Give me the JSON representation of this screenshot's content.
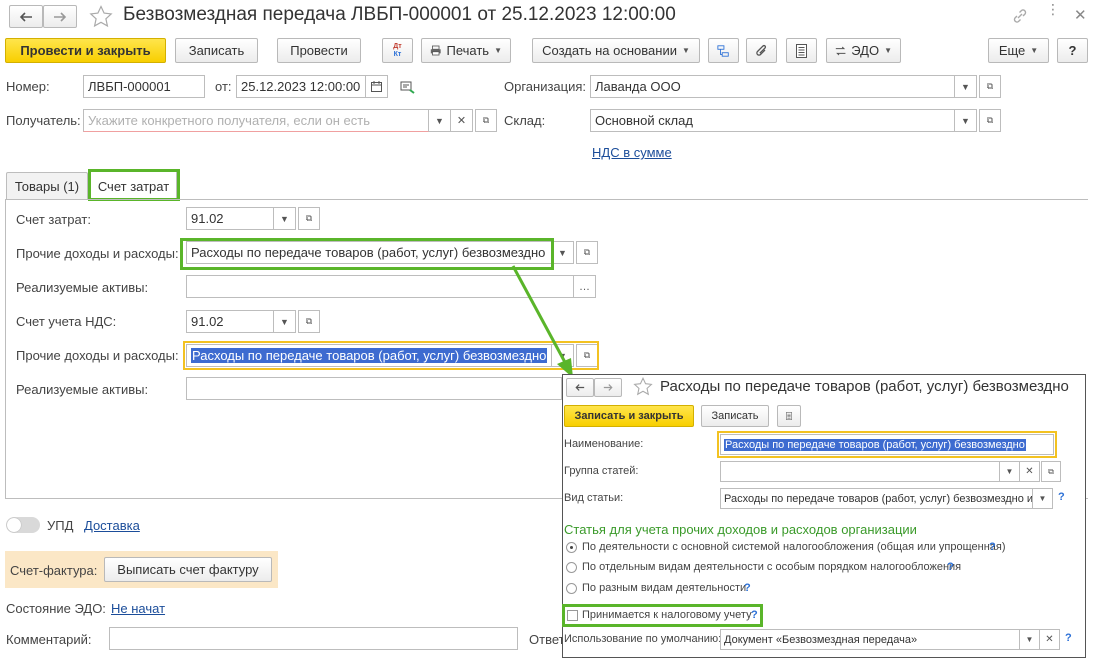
{
  "window": {
    "title": "Безвозмездная передача ЛВБП-000001 от 25.12.2023 12:00:00"
  },
  "toolbar": {
    "post_close": "Провести и закрыть",
    "save": "Записать",
    "post": "Провести",
    "dtkt": "Дт\nКт",
    "print": "Печать",
    "create_based": "Создать на основании",
    "edo": "ЭДО",
    "more": "Еще",
    "help": "?"
  },
  "header": {
    "number_label": "Номер:",
    "number_value": "ЛВБП-000001",
    "date_label": "от:",
    "date_value": "25.12.2023 12:00:00",
    "org_label": "Организация:",
    "org_value": "Лаванда ООО",
    "recipient_label": "Получатель:",
    "recipient_placeholder": "Укажите конкретного получателя, если он есть",
    "warehouse_label": "Склад:",
    "warehouse_value": "Основной склад",
    "vat_link": "НДС в сумме"
  },
  "tabs": [
    {
      "label": "Товары (1)"
    },
    {
      "label": "Счет затрат"
    }
  ],
  "cost_tab": {
    "account_label": "Счет затрат:",
    "account_value": "91.02",
    "other_label": "Прочие доходы и расходы:",
    "other_value": "Расходы по передаче товаров (работ, услуг) безвозмездно",
    "assets_label": "Реализуемые активы:",
    "vat_account_label": "Счет учета НДС:",
    "vat_account_value": "91.02",
    "other2_label": "Прочие доходы и расходы:",
    "other2_value": "Расходы по передаче товаров (работ, услуг) безвозмездно",
    "assets2_label": "Реализуемые активы:"
  },
  "footer": {
    "upd_label": "УПД",
    "delivery_link": "Доставка",
    "invoice_label": "Счет-фактура:",
    "invoice_button": "Выписать счет фактуру",
    "edo_state_label": "Состояние ЭДО:",
    "edo_state_link": "Не начат",
    "comment_label": "Комментарий:",
    "responsible_label": "Ответ"
  },
  "popup": {
    "title": "Расходы по передаче товаров (работ, услуг) безвозмездно",
    "save_close": "Записать и закрыть",
    "save": "Записать",
    "name_label": "Наименование:",
    "name_value": "Расходы по передаче товаров (работ, услуг) безвозмездно",
    "group_label": "Группа статей:",
    "kind_label": "Вид статьи:",
    "kind_value": "Расходы по передаче товаров (работ, услуг) безвозмездно и д",
    "section_title": "Статья для учета прочих доходов и расходов организации",
    "radio1": "По деятельности с основной системой налогообложения (общая или упрощенная)",
    "radio2": "По отдельным видам деятельности с особым порядком налогообложения",
    "radio3": "По разным видам деятельности",
    "tax_checkbox": "Принимается к налоговому учету",
    "default_use_label": "Использование по умолчанию:",
    "default_use_value": "Документ «Безвозмездная передача»",
    "q": "?"
  },
  "colors": {
    "highlight_green": "#5ab52a",
    "highlight_yellow": "#f3c221",
    "primary_button": "#f8cf00",
    "link": "#1b4d9a"
  }
}
